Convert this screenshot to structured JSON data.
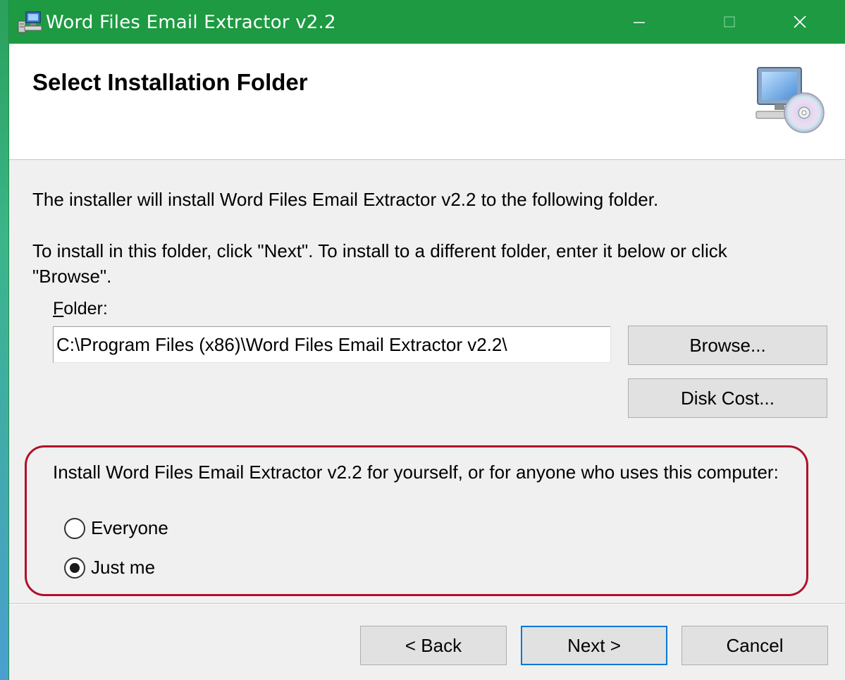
{
  "window": {
    "title": "Word Files Email Extractor v2.2",
    "app_icon": "installer-computer-icon",
    "controls": {
      "minimize": "minimize-icon",
      "maximize": "maximize-icon",
      "close": "close-icon"
    }
  },
  "header": {
    "title": "Select Installation Folder",
    "graphic": "computer-cd-icon"
  },
  "body": {
    "line1": "The installer will install Word Files Email Extractor v2.2 to the following folder.",
    "line2": "To install in this folder, click \"Next\". To install to a different folder, enter it below or click \"Browse\"."
  },
  "folder": {
    "label": "Folder:",
    "label_accesskey": "F",
    "label_rest": "older:",
    "value": "C:\\Program Files (x86)\\Word Files Email Extractor v2.2\\",
    "browse_label": "Browse...",
    "disk_cost_label": "Disk Cost..."
  },
  "install_scope": {
    "prompt": "Install Word Files Email Extractor v2.2 for yourself, or for anyone who uses this computer:",
    "options": [
      {
        "label": "Everyone",
        "selected": false
      },
      {
        "label": "Just me",
        "selected": true
      }
    ],
    "highlight_color": "#b0102a"
  },
  "footer": {
    "back_label": "< Back",
    "next_label": "Next >",
    "cancel_label": "Cancel"
  },
  "colors": {
    "titlebar": "#1d9a42",
    "focus_border": "#0078d7"
  }
}
